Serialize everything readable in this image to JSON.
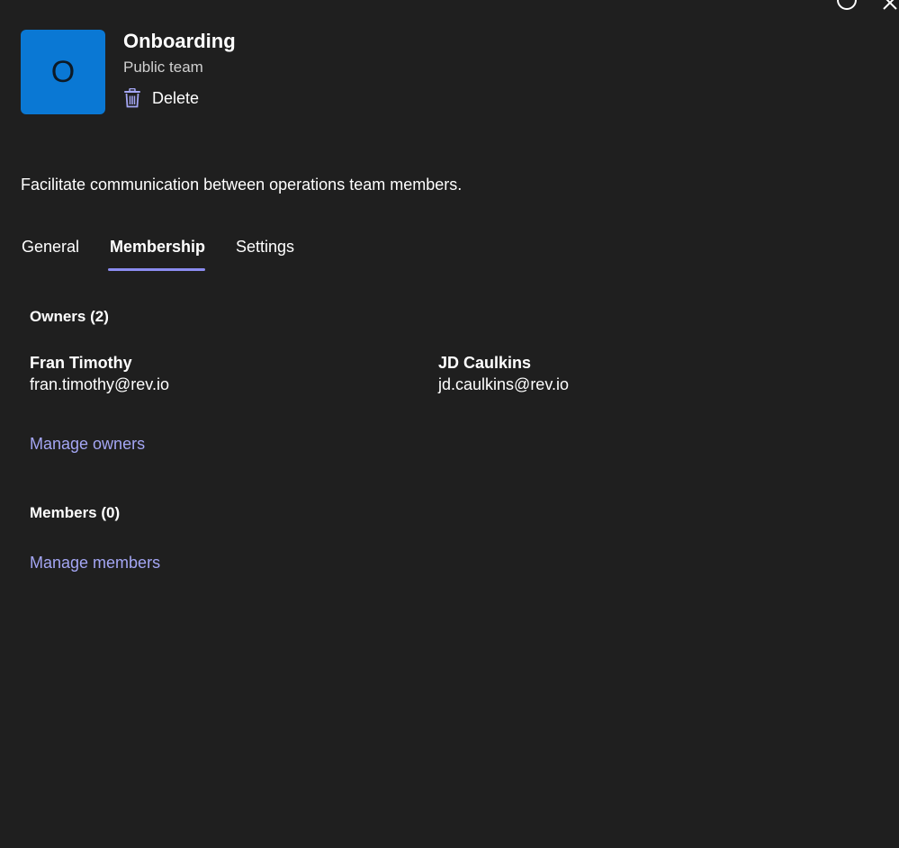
{
  "window": {
    "controls": [
      "circle-icon",
      "close-icon"
    ]
  },
  "header": {
    "avatar_letter": "O",
    "avatar_color": "#0a78d4",
    "team_name": "Onboarding",
    "team_type": "Public team",
    "delete_label": "Delete",
    "delete_icon": "trash-icon"
  },
  "description": "Facilitate communication between operations team members.",
  "tabs": [
    {
      "label": "General",
      "active": false
    },
    {
      "label": "Membership",
      "active": true
    },
    {
      "label": "Settings",
      "active": false
    }
  ],
  "owners": {
    "heading": "Owners (2)",
    "people": [
      {
        "name": "Fran Timothy",
        "email": "fran.timothy@rev.io"
      },
      {
        "name": "JD Caulkins",
        "email": "jd.caulkins@rev.io"
      }
    ],
    "manage_label": "Manage owners"
  },
  "members": {
    "heading": "Members (0)",
    "manage_label": "Manage members"
  },
  "colors": {
    "background": "#1f1f1f",
    "accent": "#8b8cf0",
    "link": "#a4a6f4"
  }
}
